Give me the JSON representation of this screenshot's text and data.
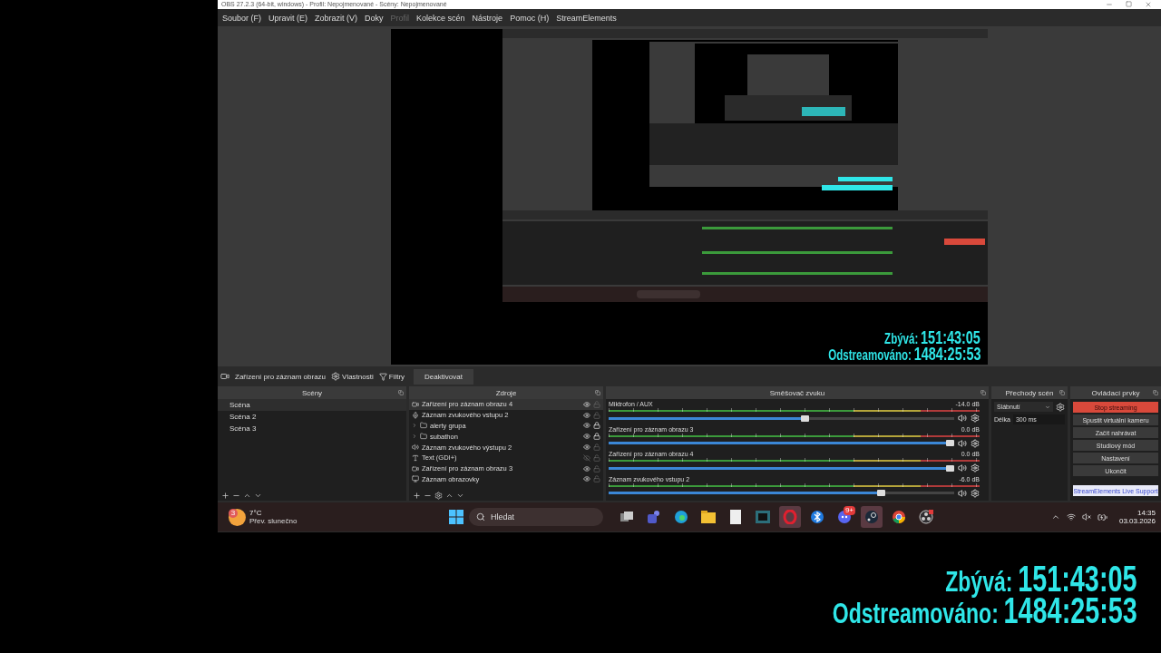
{
  "window": {
    "title": "OBS 27.2.3 (64-bit, windows) - Profil: Nepojmenované - Scény: Nepojmenované"
  },
  "menu": [
    {
      "label": "Soubor (F)",
      "disabled": false
    },
    {
      "label": "Upravit (E)",
      "disabled": false
    },
    {
      "label": "Zobrazit (V)",
      "disabled": false
    },
    {
      "label": "Doky",
      "disabled": false
    },
    {
      "label": "Profil",
      "disabled": true
    },
    {
      "label": "Kolekce scén",
      "disabled": false
    },
    {
      "label": "Nástroje",
      "disabled": false
    },
    {
      "label": "Pomoc (H)",
      "disabled": false
    },
    {
      "label": "StreamElements",
      "disabled": false
    }
  ],
  "preview": {
    "overlay": [
      {
        "label": "Zbývá:",
        "value": "151:43:05"
      },
      {
        "label": "Odstreamováno:",
        "value": "1484:25:53"
      }
    ]
  },
  "context_bar": {
    "source": "Zařízení pro záznam obrazu",
    "properties": "Vlastnosti",
    "filters": "Filtry",
    "deactivate": "Deaktivovat"
  },
  "scenes": {
    "title": "Scény",
    "items": [
      {
        "label": "Scéna",
        "selected": true
      },
      {
        "label": "Scéna 2",
        "selected": false
      },
      {
        "label": "Scéna 3",
        "selected": false
      }
    ]
  },
  "sources": {
    "title": "Zdroje",
    "items": [
      {
        "kind": "camera",
        "label": "Zařízení pro záznam obrazu 4",
        "selected": true,
        "visible": true,
        "locked": false
      },
      {
        "kind": "mic",
        "label": "Záznam zvukového vstupu 2",
        "selected": false,
        "visible": true,
        "locked": false
      },
      {
        "kind": "folder",
        "label": "alerty grupa",
        "selected": false,
        "visible": true,
        "locked": true
      },
      {
        "kind": "folder",
        "label": "subathon",
        "selected": false,
        "visible": true,
        "locked": true
      },
      {
        "kind": "speaker",
        "label": "Záznam zvukového výstupu 2",
        "selected": false,
        "visible": true,
        "locked": false
      },
      {
        "kind": "text",
        "label": "Text (GDI+)",
        "selected": false,
        "visible": false,
        "locked": false
      },
      {
        "kind": "camera",
        "label": "Zařízení pro záznam obrazu 3",
        "selected": false,
        "visible": true,
        "locked": false
      },
      {
        "kind": "monitor",
        "label": "Záznam obrazovky",
        "selected": false,
        "visible": true,
        "locked": false
      }
    ]
  },
  "mixer": {
    "title": "Směšovač zvuku",
    "channels": [
      {
        "name": "Miktrofon / AUX",
        "reading": "-14.0 dB",
        "level": 0.58
      },
      {
        "name": "Zařízení pro záznam obrazu 3",
        "reading": "0.0 dB",
        "level": 1
      },
      {
        "name": "Zařízení pro záznam obrazu 4",
        "reading": "0.0 dB",
        "level": 1
      },
      {
        "name": "Záznam zvukového vstupu 2",
        "reading": "-6.0 dB",
        "level": 0.8
      }
    ]
  },
  "transitions": {
    "title": "Přechody scén",
    "transition": "Slábnutí",
    "duration_label": "Délka",
    "duration": "300 ms"
  },
  "controls": {
    "title": "Ovládací prvky",
    "buttons": [
      {
        "label": "Stop streaming",
        "kind": "active"
      },
      {
        "label": "Spustit virtuální kameru",
        "kind": "normal"
      },
      {
        "label": "Začít nahrávat",
        "kind": "normal"
      },
      {
        "label": "Studiový mód",
        "kind": "normal"
      },
      {
        "label": "Nastavení",
        "kind": "normal"
      },
      {
        "label": "Ukončit",
        "kind": "normal"
      },
      {
        "label": "StreamElements Live Support",
        "kind": "link"
      }
    ]
  },
  "taskbar": {
    "weather": {
      "badge": "3",
      "temperature": "7°C",
      "condition": "Přev. slunečno"
    },
    "search": {
      "placeholder": "Hledat"
    },
    "apps": [
      {
        "kind": "task-view",
        "active": false
      },
      {
        "kind": "teams",
        "active": false
      },
      {
        "kind": "edge",
        "active": false
      },
      {
        "kind": "explorer",
        "active": false
      },
      {
        "kind": "notepad",
        "active": false
      },
      {
        "kind": "monitor",
        "active": false
      },
      {
        "kind": "opera",
        "active": true
      },
      {
        "kind": "bluetooth",
        "active": false
      },
      {
        "kind": "discord",
        "active": false,
        "badge": "9+"
      },
      {
        "kind": "steam",
        "active": true
      },
      {
        "kind": "chrome",
        "active": false
      },
      {
        "kind": "obs",
        "active": false
      }
    ],
    "time": "14:35",
    "date": "03.03.2026"
  },
  "stream_overlay": [
    {
      "label": "Zbývá:",
      "value": "151:43:05"
    },
    {
      "label": "Odstreamováno:",
      "value": "1484:25:53"
    }
  ]
}
